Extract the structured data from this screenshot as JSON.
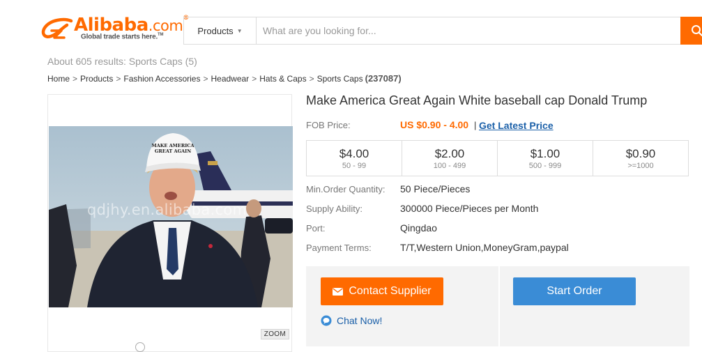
{
  "header": {
    "logo": {
      "brand": "Alibaba",
      "domain": ".com",
      "registered": "®",
      "tagline": "Global trade starts here.",
      "trademark": "TM"
    },
    "search": {
      "category": "Products",
      "placeholder": "What are you looking for...",
      "value": ""
    },
    "brand_color": "#ff6a00"
  },
  "results_summary": "About 605 results: Sports Caps (5)",
  "breadcrumb": {
    "items": [
      "Home",
      "Products",
      "Fashion Accessories",
      "Headwear",
      "Hats & Caps",
      "Sports Caps"
    ],
    "separator": ">",
    "count": "(237087)"
  },
  "gallery": {
    "image_alt": "Man in white MAKE AMERICA GREAT AGAIN baseball cap in front of a plane",
    "cap_text": "MAKE AMERICA GREAT AGAIN",
    "watermark": "qdjhy.en.alibaba.com",
    "zoom_label": "ZOOM"
  },
  "product": {
    "title": "Make America Great Again White baseball cap Donald Trump",
    "fob_label": "FOB Price:",
    "fob_price": "US $0.90 - 4.00",
    "fob_divider": "|",
    "latest_price_link": "Get Latest Price",
    "price_color": "#ff6a00",
    "tiers": [
      {
        "price": "$4.00",
        "range": "50 - 99"
      },
      {
        "price": "$2.00",
        "range": "100 - 499"
      },
      {
        "price": "$1.00",
        "range": "500 - 999"
      },
      {
        "price": "$0.90",
        "range": ">=1000"
      }
    ],
    "specs": [
      {
        "label": "Min.Order Quantity:",
        "value": "50 Piece/Pieces"
      },
      {
        "label": "Supply Ability:",
        "value": "300000 Piece/Pieces per Month"
      },
      {
        "label": "Port:",
        "value": "Qingdao"
      },
      {
        "label": "Payment Terms:",
        "value": "T/T,Western Union,MoneyGram,paypal"
      }
    ]
  },
  "actions": {
    "contact": "Contact Supplier",
    "start_order": "Start Order",
    "chat": "Chat Now!",
    "contact_color": "#ff6a00",
    "start_color": "#3a8cd6"
  }
}
